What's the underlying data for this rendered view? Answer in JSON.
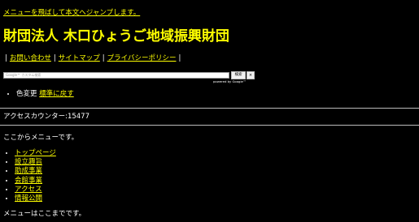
{
  "skip_link": "メニューを飛ばして本文へジャンプします。",
  "site_title": "財団法人 木口ひょうご地域振興財団",
  "utility_nav": {
    "separator": "|",
    "items": [
      "お問い合わせ",
      "サイトマップ",
      "プライバシーポリシー"
    ]
  },
  "search": {
    "placeholder": "Google™ カスタム検索",
    "button_label": "検索",
    "clear_label": "×",
    "powered_by": "powered by Google™"
  },
  "color_change": {
    "label": "色変更",
    "reset_link": "標準に戻す"
  },
  "counter": "アクセスカウンター:15477",
  "menu": {
    "start_text": "ここからメニューです。",
    "items": [
      "トップページ",
      "設立趣旨",
      "助成事業",
      "会館事業",
      "アクセス",
      "情報公開"
    ],
    "end_text": "メニューはここまでです。"
  },
  "colors": {
    "background": "#000000",
    "link": "#ffff00",
    "text": "#ffffff"
  }
}
